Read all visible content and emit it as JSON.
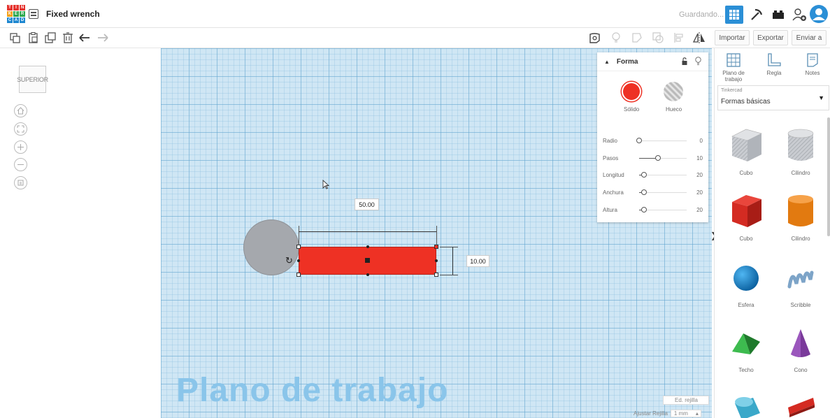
{
  "app": {
    "logo_letters": [
      "T",
      "I",
      "N",
      "K",
      "E",
      "R",
      "C",
      "A",
      "D"
    ],
    "document_title": "Fixed wrench",
    "status": "Guardando...",
    "accent": "#2b8fd6"
  },
  "toolbar": {
    "edit_icons": [
      "copy-icon",
      "paste-icon",
      "duplicate-icon",
      "trash-icon",
      "undo-icon",
      "redo-icon"
    ],
    "view_icons": [
      "notes-visibility-icon",
      "lightbulb-icon",
      "group-icon",
      "ungroup-icon",
      "align-icon",
      "mirror-icon"
    ],
    "import_label": "Importar",
    "export_label": "Exportar",
    "send_label": "Enviar a"
  },
  "view_cube": {
    "face": "SUPERIOR"
  },
  "workplane": {
    "label": "Plano de trabajo",
    "dim_length": "50.00",
    "dim_width": "10.00",
    "edit_grid": "Ed. rejilla",
    "snap_label": "Ajustar Rejilla",
    "snap_value": "1 mm",
    "grid_color": "#cfe6f4"
  },
  "shape_panel": {
    "title": "Forma",
    "solid_label": "Sólido",
    "hole_label": "Hueco",
    "solid_color": "#ee3124",
    "properties": [
      {
        "label": "Radio",
        "value": "0",
        "level": 0.0
      },
      {
        "label": "Pasos",
        "value": "10",
        "level": 0.4
      },
      {
        "label": "Longitud",
        "value": "20",
        "level": 0.1
      },
      {
        "label": "Anchura",
        "value": "20",
        "level": 0.1
      },
      {
        "label": "Altura",
        "value": "20",
        "level": 0.1
      }
    ]
  },
  "right_panel": {
    "tools": [
      {
        "label": "Plano de trabajo",
        "icon": "workplane-icon"
      },
      {
        "label": "Regla",
        "icon": "ruler-icon"
      },
      {
        "label": "Notes",
        "icon": "notes-icon"
      }
    ],
    "library_source": "Tinkercad",
    "library_name": "Formas básicas",
    "shapes": [
      {
        "label": "Cubo",
        "color": "#b8bcc2"
      },
      {
        "label": "Cilindro",
        "color": "#b8bcc2"
      },
      {
        "label": "Cubo",
        "color": "#d42b22"
      },
      {
        "label": "Cilindro",
        "color": "#f08a1c"
      },
      {
        "label": "Esfera",
        "color": "#1a8ad0"
      },
      {
        "label": "Scribble",
        "color": "#7da4c8"
      },
      {
        "label": "Techo",
        "color": "#2e9a3e"
      },
      {
        "label": "Cono",
        "color": "#7a3a9a"
      }
    ]
  }
}
